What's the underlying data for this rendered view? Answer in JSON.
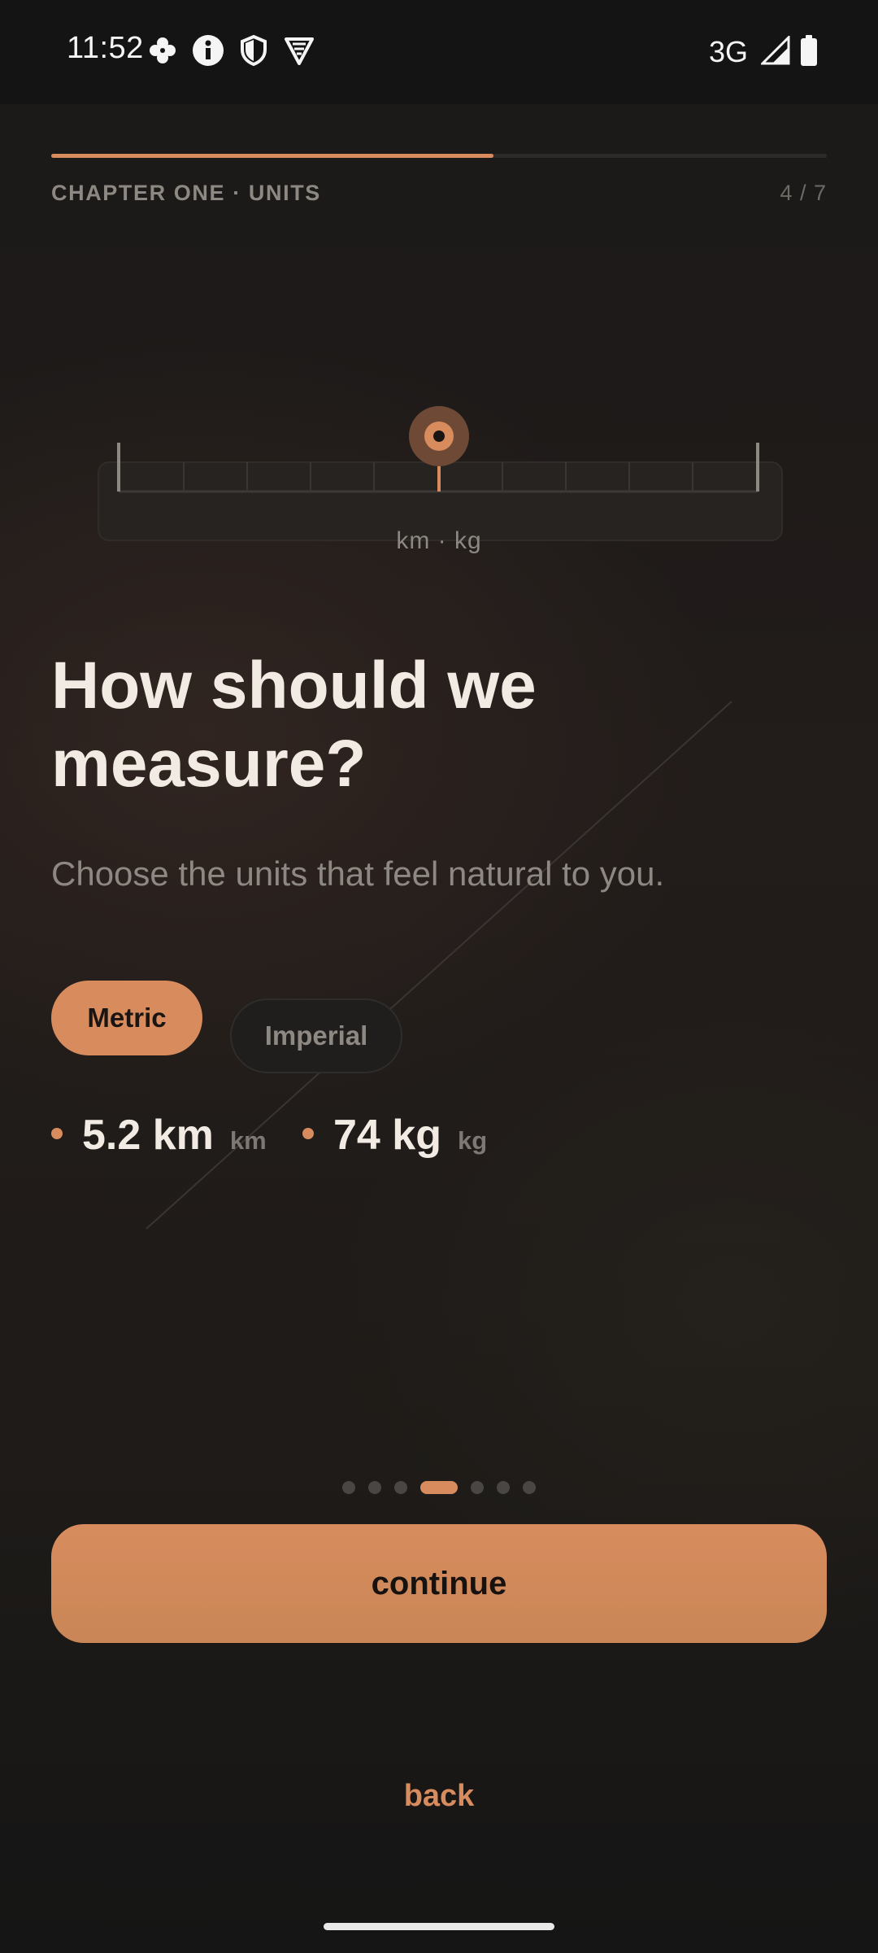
{
  "status_bar": {
    "time": "11:52",
    "network": "3G",
    "icons": [
      "pinwheel-icon",
      "info-icon",
      "shield-icon",
      "vpn-shield-icon",
      "signal-icon",
      "battery-icon"
    ]
  },
  "progress": {
    "fraction": 0.57,
    "chapter": "CHAPTER ONE · UNITS",
    "step": "4 / 7"
  },
  "ruler": {
    "caption": "km · kg"
  },
  "headline": "How should we measure?",
  "subtitle": "Choose the units that feel natural to you.",
  "units_toggle": {
    "selected": "Metric",
    "options": [
      "Metric",
      "Imperial"
    ]
  },
  "readouts": [
    {
      "value": "5.2 km",
      "unit": "km"
    },
    {
      "value": "74 kg",
      "unit": "kg"
    }
  ],
  "pagination": {
    "total": 7,
    "current": 4
  },
  "actions": {
    "continue": "continue",
    "back": "back"
  },
  "colors": {
    "accent": "#d88c5e",
    "background": "#1e1b18",
    "text_primary": "#f1ebe3",
    "text_muted": "#8d8882"
  }
}
